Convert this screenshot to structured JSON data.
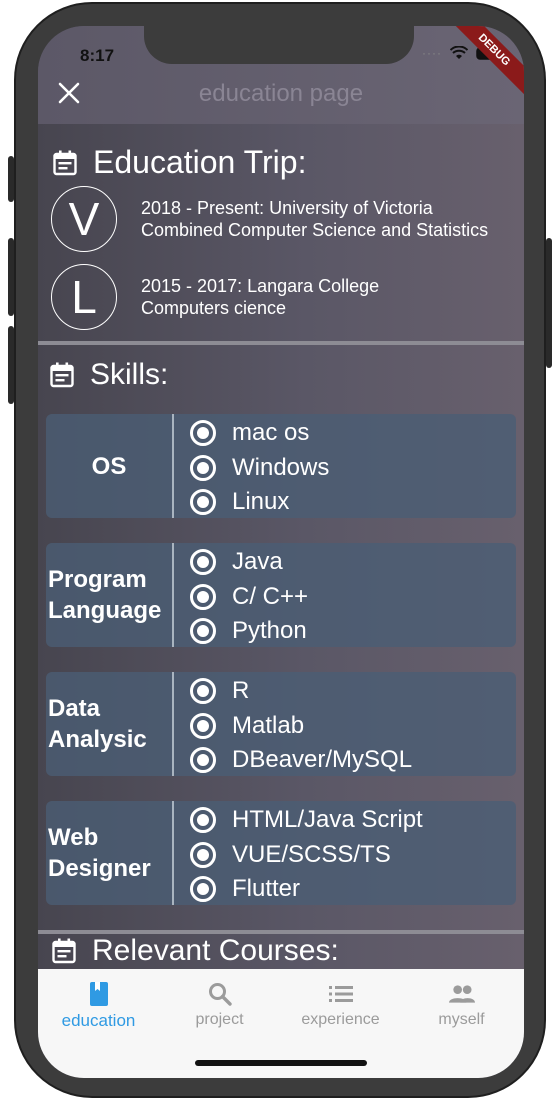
{
  "status_bar": {
    "time": "8:17",
    "debug_label": "DEBUG"
  },
  "app_bar": {
    "title": "education page",
    "close_icon": "close-icon"
  },
  "education": {
    "title": "Education Trip:",
    "entries": [
      {
        "letter": "V",
        "line1": "2018 - Present: University of Victoria",
        "line2": "Combined Computer Science and Statistics"
      },
      {
        "letter": "L",
        "line1": "2015 - 2017: Langara College",
        "line2": "Computers cience"
      }
    ]
  },
  "skills": {
    "title": "Skills:",
    "groups": [
      {
        "label": "OS",
        "items": [
          "mac os",
          "Windows",
          "Linux"
        ]
      },
      {
        "label": "Program Language",
        "items": [
          "Java",
          "C/ C++",
          "Python"
        ]
      },
      {
        "label": "Data Analysic",
        "items": [
          "R",
          "Matlab",
          "DBeaver/MySQL"
        ]
      },
      {
        "label": "Web Designer",
        "items": [
          "HTML/Java Script",
          "VUE/SCSS/TS",
          "Flutter"
        ]
      }
    ]
  },
  "courses": {
    "title": "Relevant Courses:"
  },
  "bottom_nav": {
    "active_color": "#2f9ae3",
    "items": [
      {
        "label": "education",
        "icon": "book-icon"
      },
      {
        "label": "project",
        "icon": "search-icon"
      },
      {
        "label": "experience",
        "icon": "list-icon"
      },
      {
        "label": "myself",
        "icon": "people-icon"
      }
    ]
  }
}
